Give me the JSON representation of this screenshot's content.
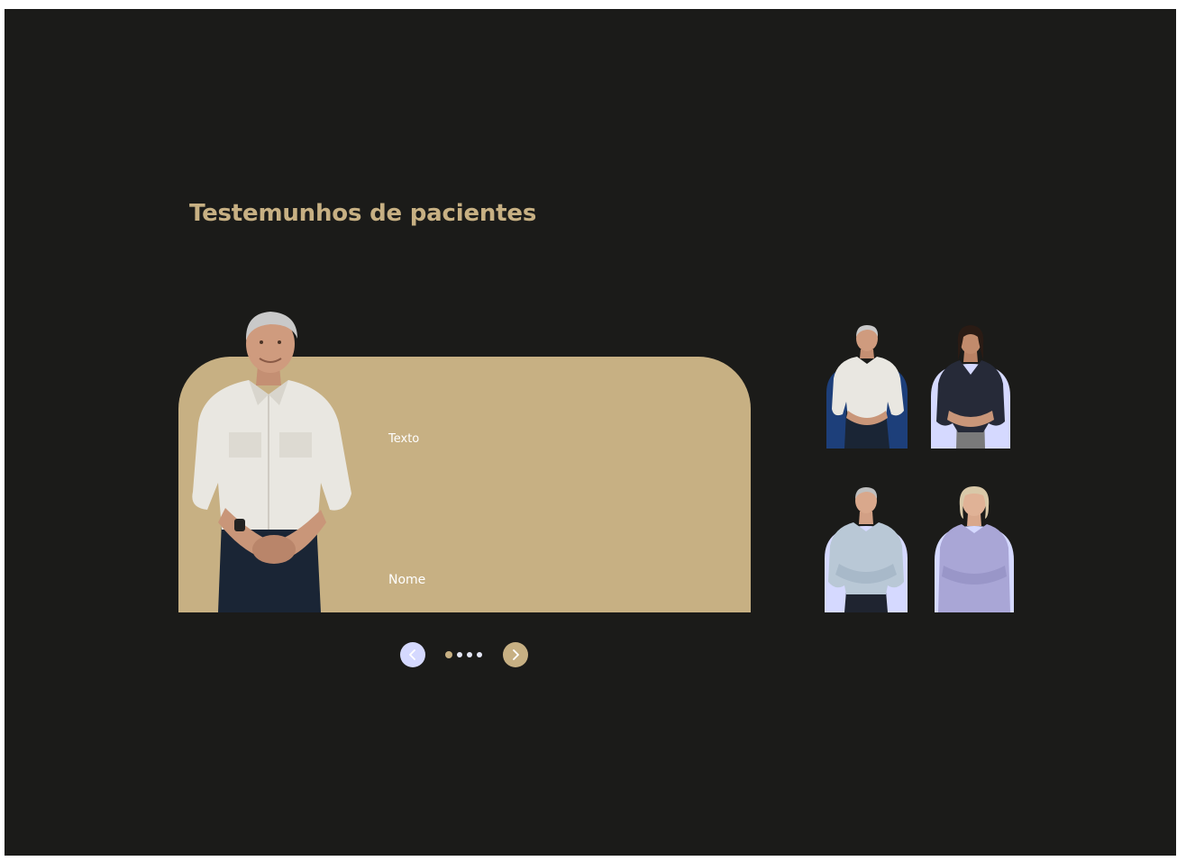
{
  "section": {
    "title": "Testemunhos de pacientes"
  },
  "testimonial": {
    "text": "Texto",
    "name": "Nome"
  },
  "carousel": {
    "prev_icon": "chevron-left-icon",
    "next_icon": "chevron-right-icon",
    "dots": 4,
    "active_index": 0
  },
  "colors": {
    "background": "#1b1b19",
    "accent": "#c7b083",
    "lavender": "#d5d9ff",
    "navy": "#1d3f7a"
  }
}
